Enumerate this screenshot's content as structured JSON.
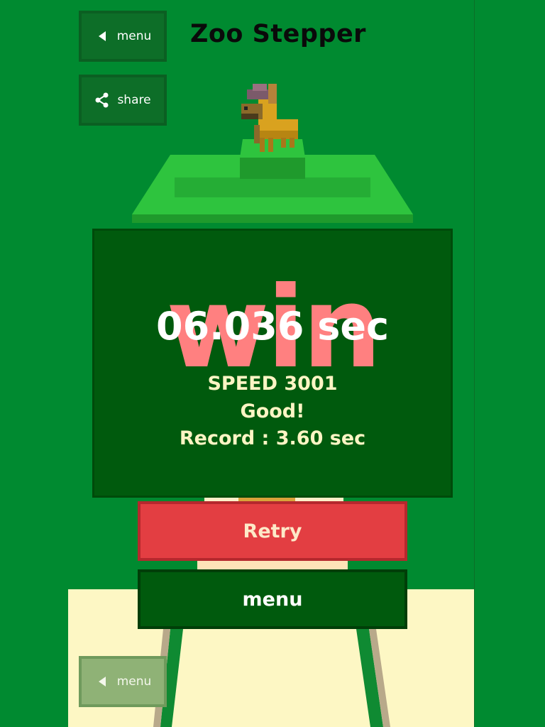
{
  "header": {
    "title": "Zoo Stepper",
    "menu_button_label": "menu",
    "share_button_label": "share"
  },
  "result_panel": {
    "win_text": "win",
    "time_text": "06.036 sec",
    "speed_text": "SPEED 3001",
    "rating_text": "Good!",
    "record_text": "Record : 3.60 sec"
  },
  "actions": {
    "retry_label": "Retry",
    "menu_label": "menu"
  },
  "footer": {
    "menu_button_label": "menu"
  },
  "colors": {
    "background": "#008a30",
    "panel": "#005a0d",
    "win_text": "#ff8080",
    "retry_button": "#e33e42",
    "menu_button": "#005a0d",
    "floor": "#fdf7c4"
  },
  "icons": {
    "menu": "left-triangle-icon",
    "share": "share-icon"
  }
}
